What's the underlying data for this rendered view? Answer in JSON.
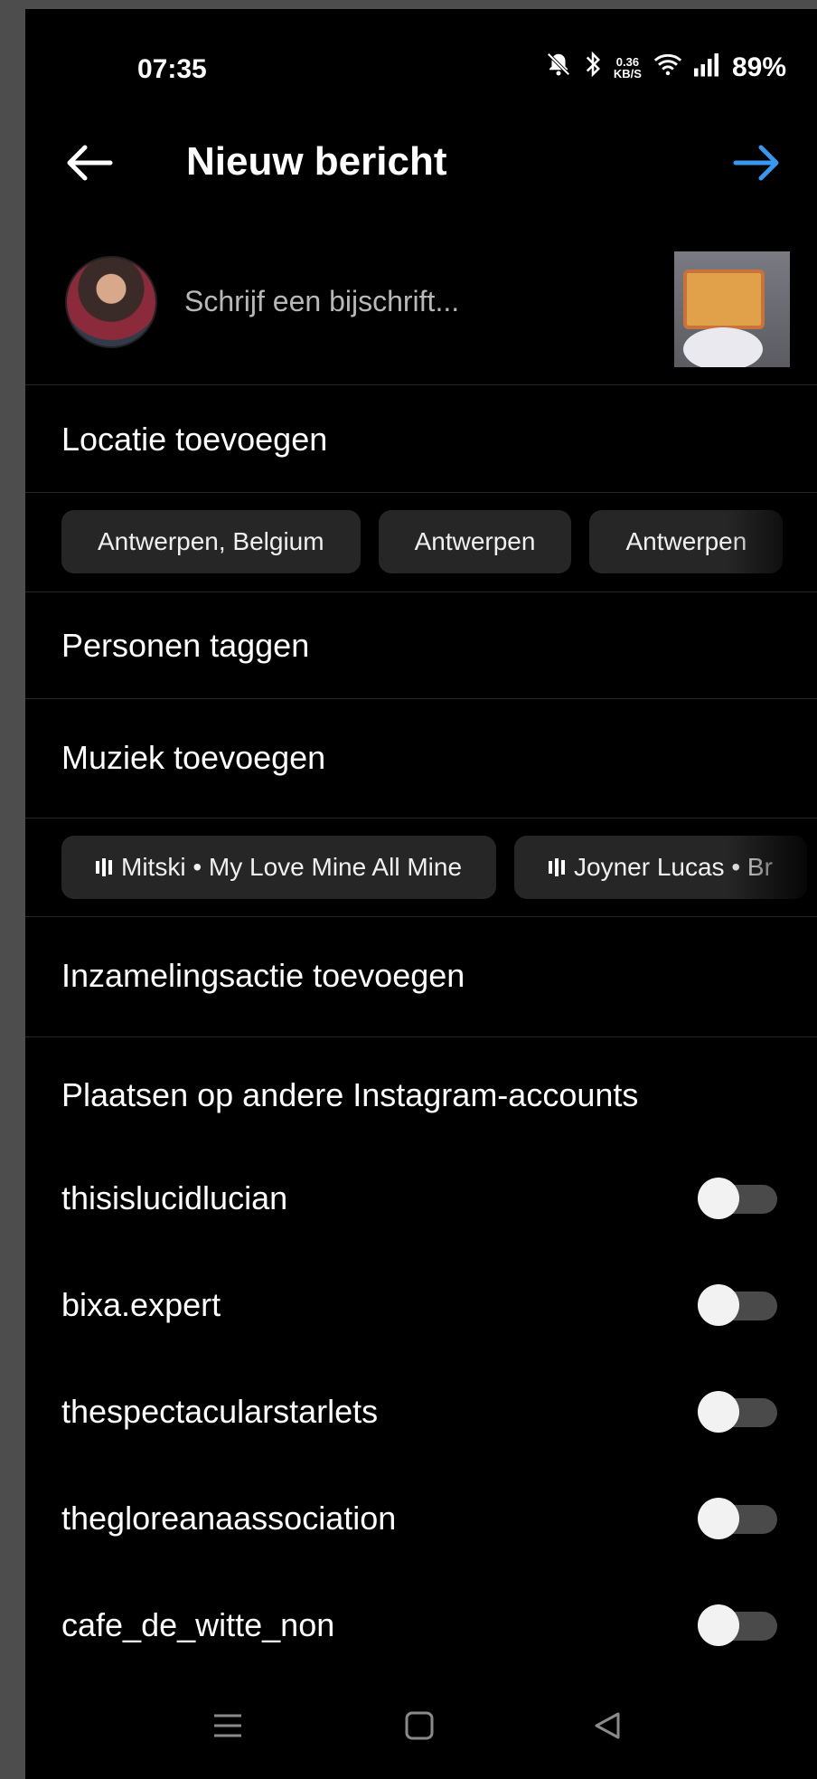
{
  "status_bar": {
    "time": "07:35",
    "net_speed_value": "0.36",
    "net_speed_unit": "KB/S",
    "battery": "89%",
    "icons": [
      "bell-muted-icon",
      "bluetooth-icon",
      "wifi-icon",
      "signal-icon"
    ]
  },
  "header": {
    "title": "Nieuw bericht",
    "back_icon": "arrow-left-icon",
    "next_icon": "arrow-right-icon",
    "accent_color": "#3897f0"
  },
  "caption": {
    "placeholder": "Schrijf een bijschrift..."
  },
  "location": {
    "label": "Locatie toevoegen",
    "suggestions": [
      "Antwerpen, Belgium",
      "Antwerpen",
      "Antwerpen"
    ]
  },
  "tag_people": {
    "label": "Personen taggen"
  },
  "music": {
    "label": "Muziek toevoegen",
    "suggestions": [
      "Mitski • My Love Mine All Mine",
      "Joyner Lucas • Br"
    ]
  },
  "fundraiser": {
    "label": "Inzamelingsactie toevoegen"
  },
  "cross_post": {
    "label": "Plaatsen op andere Instagram-accounts",
    "accounts": [
      {
        "name": "thisislucidlucian",
        "enabled": false
      },
      {
        "name": "bixa.expert",
        "enabled": false
      },
      {
        "name": "thespectacularstarlets",
        "enabled": false
      },
      {
        "name": "thegloreanaassociation",
        "enabled": false
      },
      {
        "name": "cafe_de_witte_non",
        "enabled": false
      }
    ]
  },
  "nav_bar": {
    "icons": [
      "menu-icon",
      "home-square-icon",
      "back-triangle-icon"
    ]
  }
}
